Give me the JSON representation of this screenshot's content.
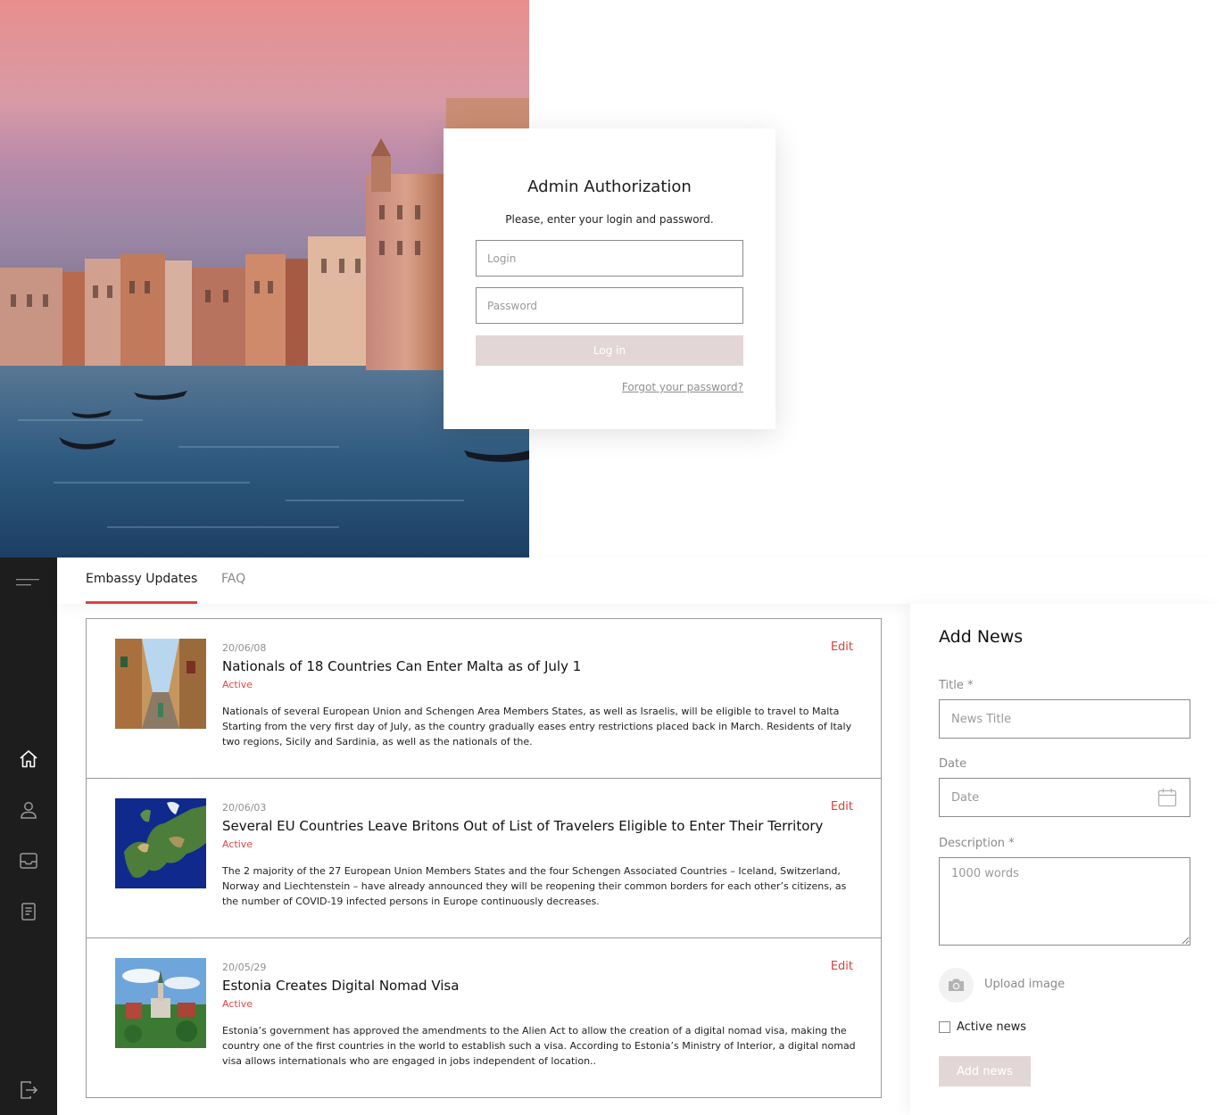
{
  "login": {
    "title": "Admin Authorization",
    "subtitle": "Please, enter your login and password.",
    "login_placeholder": "Login",
    "password_placeholder": "Password",
    "button_label": "Log in",
    "forgot_link": "Forgot your password?"
  },
  "sidebar": {
    "icons": [
      "menu-icon",
      "home-icon",
      "user-icon",
      "inbox-icon",
      "document-icon",
      "logout-icon"
    ]
  },
  "tabs": [
    {
      "label": "Embassy Updates",
      "active": true
    },
    {
      "label": "FAQ",
      "active": false
    }
  ],
  "news": [
    {
      "date": "20/06/08",
      "title": "Nationals of 18 Countries Can Enter Malta as of July 1",
      "status": "Active",
      "description": "Nationals of several European Union and Schengen Area Members States, as well as Israelis, will be eligible to travel to Malta Starting from the very first day of July, as the country gradually eases entry restrictions placed back in March. Residents of Italy two regions, Sicily and Sardinia, as well as the nationals of the.",
      "edit": "Edit"
    },
    {
      "date": "20/06/03",
      "title": "Several EU Countries Leave Britons Out of List of Travelers Eligible to Enter Their Territory",
      "status": "Active",
      "description": "The 2 majority of the 27 European Union Members States and the four Schengen Associated Countries – Iceland, Switzerland, Norway and Liechtenstein – have already announced they will be reopening their common borders for each other’s citizens, as the number of COVID-19 infected persons in Europe continuously decreases.",
      "edit": "Edit"
    },
    {
      "date": "20/05/29",
      "title": "Estonia Creates Digital Nomad Visa",
      "status": "Active",
      "description": "Estonia’s government has approved the amendments to the Alien Act to allow the creation of a digital nomad visa, making the country one of the first countries in the world to establish such a visa. According to Estonia’s Ministry of Interior, a digital nomad visa allows internationals who are engaged in jobs independent of location..",
      "edit": "Edit"
    }
  ],
  "add_news": {
    "heading": "Add News",
    "title_label": "Title *",
    "title_placeholder": "News Title",
    "date_label": "Date",
    "date_placeholder": "Date",
    "description_label": "Description *",
    "description_placeholder": "1000 words",
    "upload_label": "Upload image",
    "active_label": "Active news",
    "active_checked": false,
    "button_label": "Add news"
  },
  "colors": {
    "accent": "#e04040",
    "button_disabled": "#e3d6d7",
    "sidebar": "#1d1d1d"
  }
}
